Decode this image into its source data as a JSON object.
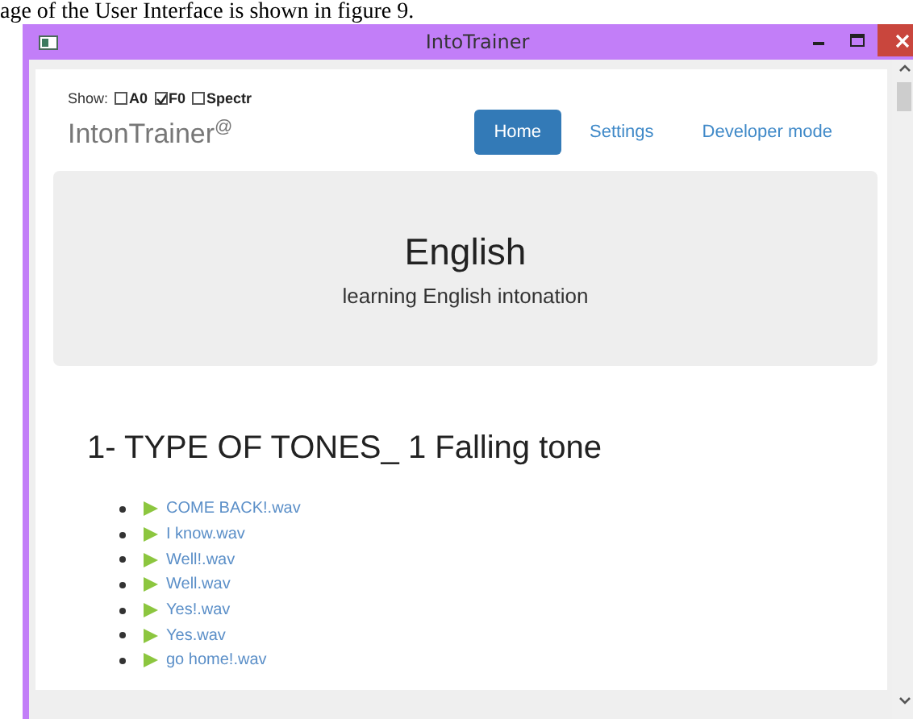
{
  "caption": "age of the User Interface is shown in figure 9.",
  "window": {
    "title": "IntoTrainer"
  },
  "show": {
    "label": "Show:",
    "options": [
      {
        "label": "A0",
        "checked": false
      },
      {
        "label": "F0",
        "checked": true
      },
      {
        "label": "Spectr",
        "checked": false
      }
    ]
  },
  "brand": {
    "name": "IntonTrainer",
    "mark": "@"
  },
  "nav": [
    {
      "label": "Home",
      "selected": true
    },
    {
      "label": "Settings",
      "selected": false
    },
    {
      "label": "Developer mode",
      "selected": false
    }
  ],
  "hero": {
    "title": "English",
    "subtitle": "learning English intonation"
  },
  "section": {
    "heading": "1- TYPE OF TONES_ 1 Falling tone",
    "files": [
      "COME BACK!.wav",
      "I know.wav",
      "Well!.wav",
      "Well.wav",
      "Yes!.wav",
      "Yes.wav",
      "go home!.wav"
    ]
  }
}
